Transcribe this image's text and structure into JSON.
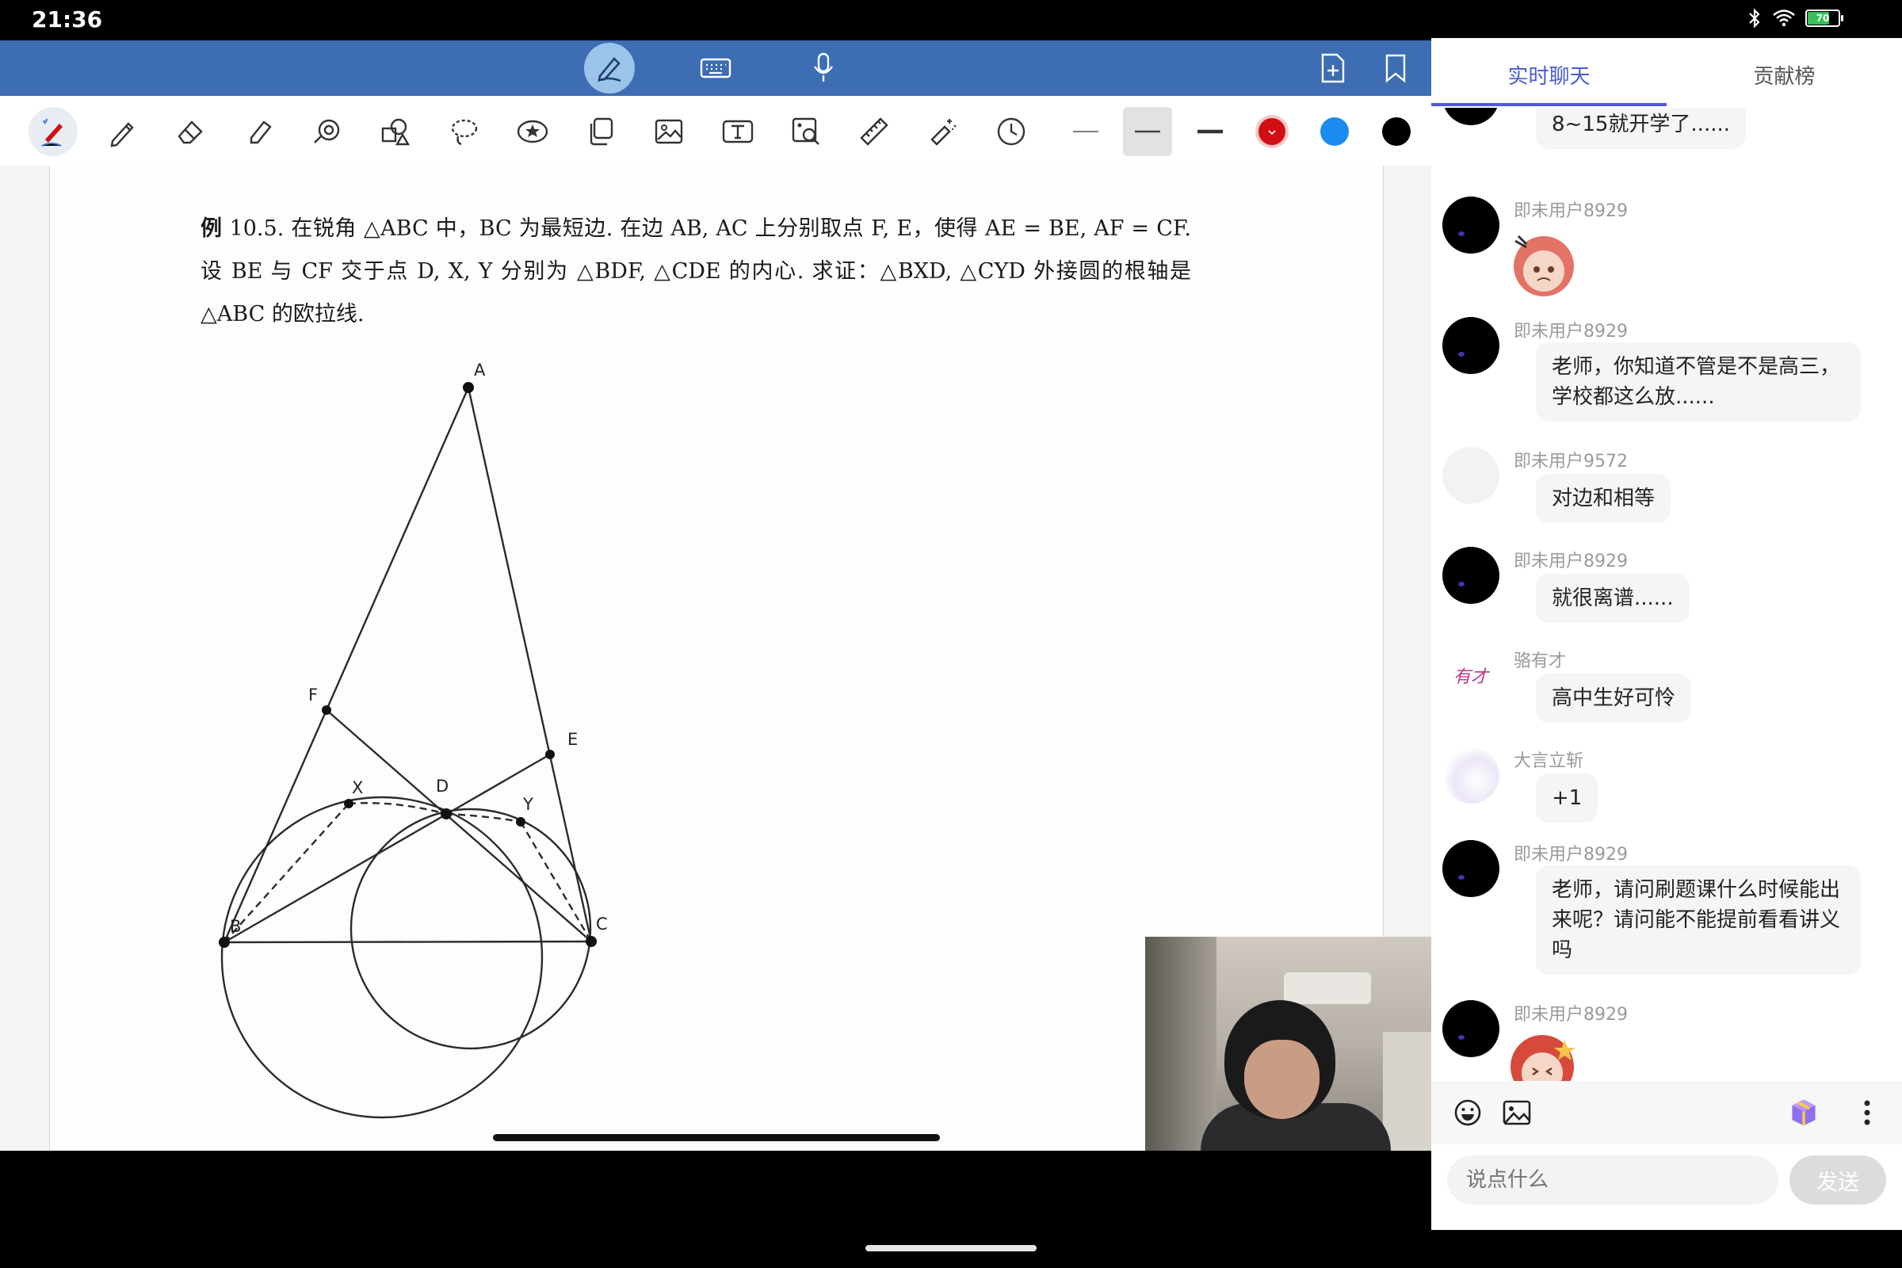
{
  "status_bar": {
    "time": "21:36",
    "battery_level": "70"
  },
  "problem": {
    "label": "例",
    "line1": " 10.5. 在锐角 △ABC 中，BC 为最短边. 在边 AB, AC 上分别取点 F, E，使得 AE = BE, AF = CF. 设 BE 与 CF 交于点 D, X, Y 分别为 △BDF, △CDE 的内心. 求证：△BXD, △CYD 外接圆的根轴是 △ABC 的欧拉线."
  },
  "diagram": {
    "points": {
      "A": "A",
      "B": "B",
      "C": "C",
      "D": "D",
      "E": "E",
      "F": "F",
      "X": "X",
      "Y": "Y"
    }
  },
  "chat": {
    "tabs": {
      "live_chat": "实时聊天",
      "contribution": "贡献榜"
    },
    "messages": [
      {
        "user": "",
        "text": "8~15就开学了......"
      },
      {
        "user": "即未用户8929",
        "text": ""
      },
      {
        "user": "即未用户8929",
        "text": "老师，你知道不管是不是高三，学校都这么放......"
      },
      {
        "user": "即未用户9572",
        "text": "对边和相等"
      },
      {
        "user": "即未用户8929",
        "text": "就很离谱......"
      },
      {
        "user": "骆有才",
        "text": "高中生好可怜"
      },
      {
        "user": "大言立斩",
        "text": "+1"
      },
      {
        "user": "即未用户8929",
        "text": "老师，请问刷题课什么时候能出来呢？请问能不能提前看看讲义吗"
      },
      {
        "user": "即未用户8929",
        "text": ""
      }
    ],
    "avatar_sign_text": "有才",
    "input_placeholder": "说点什么",
    "send_label": "发送"
  },
  "colors": {
    "toolbar_blue": "#3d6db2",
    "tab_accent": "#4a5bd4",
    "pen_red": "#d10e14",
    "pen_blue": "#1a8cf0",
    "pen_black": "#000000"
  }
}
